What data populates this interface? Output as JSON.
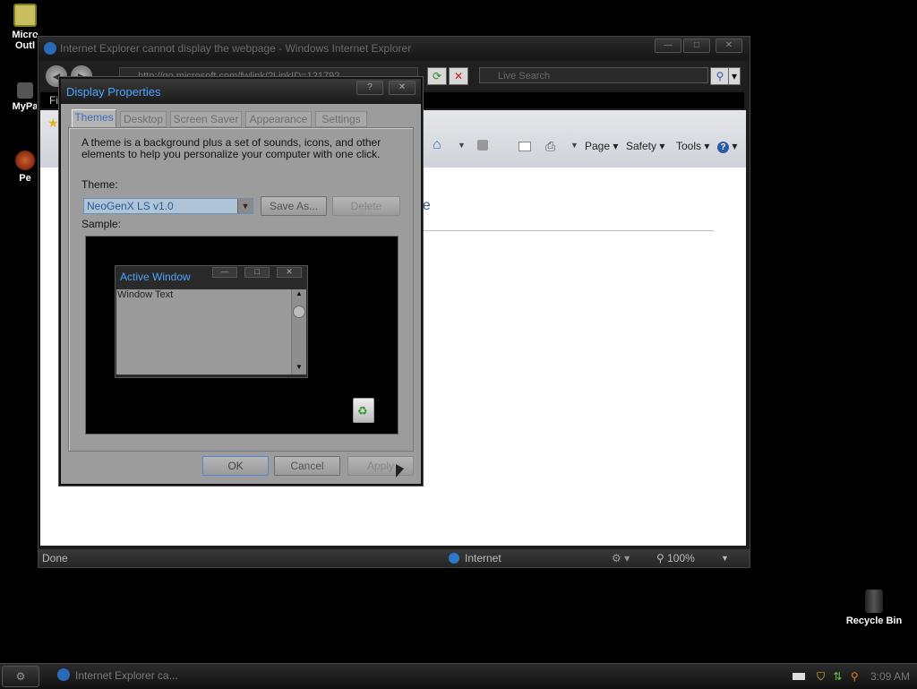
{
  "desktop": {
    "icons": [
      {
        "label": "Micro Outl",
        "name": "outlook"
      },
      {
        "label": "MyPa",
        "name": "mypage"
      },
      {
        "label": "Pe",
        "name": "pe"
      },
      {
        "label": "Recycle Bin",
        "name": "recycle-bin"
      }
    ]
  },
  "ie": {
    "title": "Internet Explorer cannot display the webpage - Windows Internet Explorer",
    "address": "http://go.microsoft.com/fwlink/?LinkID=121792",
    "search_placeholder": "Live Search",
    "menu_label": "Fil",
    "commands": {
      "page": "Page",
      "safety": "Safety",
      "tools": "Tools",
      "help": "?"
    },
    "content_heading": "ge",
    "status_left": "Done",
    "status_zone": "Internet",
    "zoom": "100%"
  },
  "dialog": {
    "title": "Display Properties",
    "tabs": [
      {
        "label": "Themes",
        "active": true
      },
      {
        "label": "Desktop",
        "active": false
      },
      {
        "label": "Screen Saver",
        "active": false
      },
      {
        "label": "Appearance",
        "active": false
      },
      {
        "label": "Settings",
        "active": false
      }
    ],
    "description": "A theme is a background plus a set of sounds, icons, and other elements to help you personalize your computer with one click.",
    "theme_label": "Theme:",
    "theme_value": "NeoGenX LS v1.0",
    "save_as_label": "Save As...",
    "delete_label": "Delete",
    "sample_label": "Sample:",
    "sample_window": {
      "title": "Active Window",
      "text": "Window Text"
    },
    "ok_label": "OK",
    "cancel_label": "Cancel",
    "apply_label": "Apply"
  },
  "taskbar": {
    "task_label": "Internet Explorer ca...",
    "clock": "3:09 AM"
  },
  "colors": {
    "accent": "#4aa3ff",
    "desktop": "#000000"
  }
}
